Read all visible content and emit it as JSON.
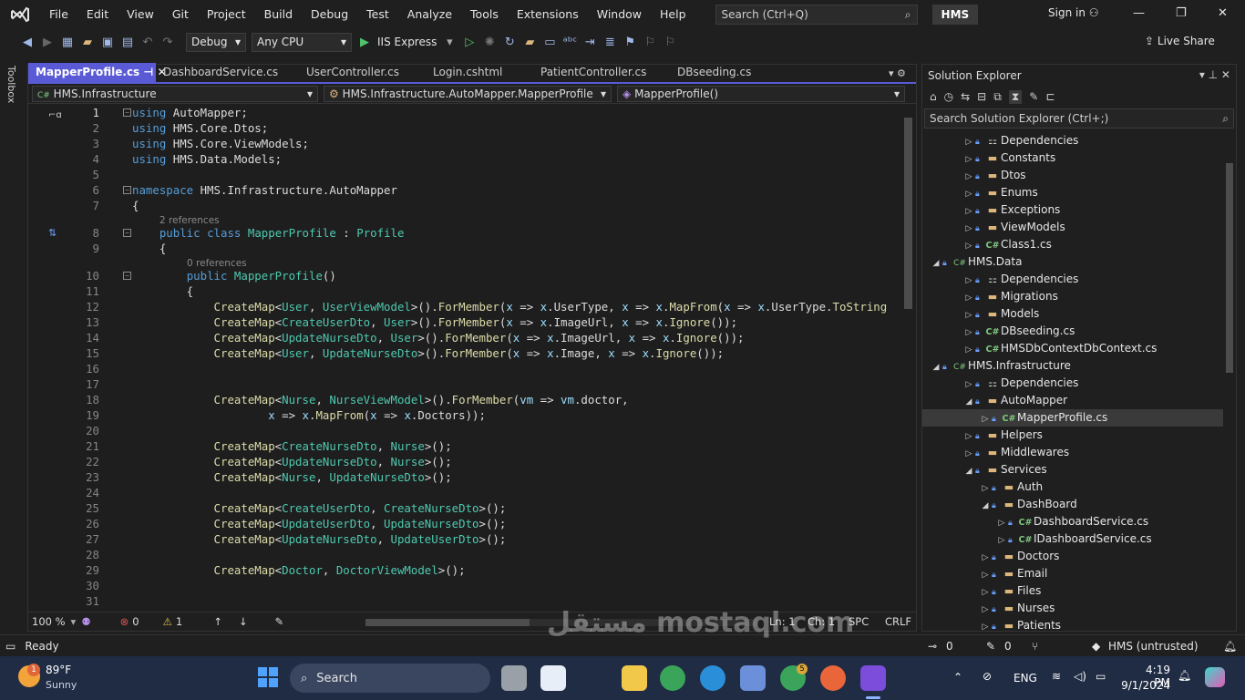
{
  "menu": [
    "File",
    "Edit",
    "View",
    "Git",
    "Project",
    "Build",
    "Debug",
    "Test",
    "Analyze",
    "Tools",
    "Extensions",
    "Window",
    "Help"
  ],
  "search": {
    "placeholder": "Search (Ctrl+Q)"
  },
  "solution_badge": "HMS",
  "signin": "Sign in",
  "toolbar": {
    "config": "Debug",
    "platform": "Any CPU",
    "run_label": "IIS Express",
    "live_share": "Live Share"
  },
  "toolbox_label": "Toolbox",
  "tabs": [
    "MapperProfile.cs",
    "DashboardService.cs",
    "UserController.cs",
    "Login.cshtml",
    "PatientController.cs",
    "DBseeding.cs"
  ],
  "nav": {
    "project": "HMS.Infrastructure",
    "class": "HMS.Infrastructure.AutoMapper.MapperProfile",
    "member": "MapperProfile()"
  },
  "code_lines": [
    {
      "n": "1",
      "t": "using AutoMapper;"
    },
    {
      "n": "2",
      "t": "using HMS.Core.Dtos;"
    },
    {
      "n": "3",
      "t": "using HMS.Core.ViewModels;"
    },
    {
      "n": "4",
      "t": "using HMS.Data.Models;"
    },
    {
      "n": "5",
      "t": ""
    },
    {
      "n": "6",
      "t": "namespace HMS.Infrastructure.AutoMapper"
    },
    {
      "n": "7",
      "t": "{"
    },
    {
      "n": "",
      "t": "2 references"
    },
    {
      "n": "8",
      "t": "    public class MapperProfile : Profile"
    },
    {
      "n": "9",
      "t": "    {"
    },
    {
      "n": "",
      "t": "0 references"
    },
    {
      "n": "10",
      "t": "        public MapperProfile()"
    },
    {
      "n": "11",
      "t": "        {"
    },
    {
      "n": "12",
      "t": "            CreateMap<User, UserViewModel>().ForMember(x => x.UserType, x => x.MapFrom(x => x.UserType.ToString"
    },
    {
      "n": "13",
      "t": "            CreateMap<CreateUserDto, User>().ForMember(x => x.ImageUrl, x => x.Ignore());"
    },
    {
      "n": "14",
      "t": "            CreateMap<UpdateNurseDto, User>().ForMember(x => x.ImageUrl, x => x.Ignore());"
    },
    {
      "n": "15",
      "t": "            CreateMap<User, UpdateNurseDto>().ForMember(x => x.Image, x => x.Ignore());"
    },
    {
      "n": "16",
      "t": ""
    },
    {
      "n": "17",
      "t": ""
    },
    {
      "n": "18",
      "t": "            CreateMap<Nurse, NurseViewModel>().ForMember(vm => vm.doctor,"
    },
    {
      "n": "19",
      "t": "                    x => x.MapFrom(x => x.Doctors));"
    },
    {
      "n": "20",
      "t": ""
    },
    {
      "n": "21",
      "t": "            CreateMap<CreateNurseDto, Nurse>();"
    },
    {
      "n": "22",
      "t": "            CreateMap<UpdateNurseDto, Nurse>();"
    },
    {
      "n": "23",
      "t": "            CreateMap<Nurse, UpdateNurseDto>();"
    },
    {
      "n": "24",
      "t": ""
    },
    {
      "n": "25",
      "t": "            CreateMap<CreateUserDto, CreateNurseDto>();"
    },
    {
      "n": "26",
      "t": "            CreateMap<UpdateUserDto, UpdateNurseDto>();"
    },
    {
      "n": "27",
      "t": "            CreateMap<UpdateNurseDto, UpdateUserDto>();"
    },
    {
      "n": "28",
      "t": ""
    },
    {
      "n": "29",
      "t": "            CreateMap<Doctor, DoctorViewModel>();"
    },
    {
      "n": "30",
      "t": ""
    },
    {
      "n": "31",
      "t": ""
    }
  ],
  "editor_status": {
    "zoom": "100 %",
    "errors": "0",
    "warnings": "1",
    "line": "Ln: 1",
    "col": "Ch: 1",
    "spc": "SPC",
    "crlf": "CRLF"
  },
  "solution_explorer": {
    "title": "Solution Explorer",
    "search_placeholder": "Search Solution Explorer (Ctrl+;)",
    "nodes": [
      {
        "label": "Dependencies",
        "depth": 1,
        "icon": "dep",
        "exp": "▷"
      },
      {
        "label": "Constants",
        "depth": 1,
        "icon": "folder",
        "exp": "▷"
      },
      {
        "label": "Dtos",
        "depth": 1,
        "icon": "folder",
        "exp": "▷"
      },
      {
        "label": "Enums",
        "depth": 1,
        "icon": "folder",
        "exp": "▷"
      },
      {
        "label": "Exceptions",
        "depth": 1,
        "icon": "folder",
        "exp": "▷"
      },
      {
        "label": "ViewModels",
        "depth": 1,
        "icon": "folder",
        "exp": "▷"
      },
      {
        "label": "Class1.cs",
        "depth": 1,
        "icon": "cs",
        "exp": "▷"
      },
      {
        "label": "HMS.Data",
        "depth": 0,
        "icon": "proj",
        "exp": "◢"
      },
      {
        "label": "Dependencies",
        "depth": 1,
        "icon": "dep",
        "exp": "▷"
      },
      {
        "label": "Migrations",
        "depth": 1,
        "icon": "folder",
        "exp": "▷"
      },
      {
        "label": "Models",
        "depth": 1,
        "icon": "folder",
        "exp": "▷"
      },
      {
        "label": "DBseeding.cs",
        "depth": 1,
        "icon": "cs",
        "exp": "▷"
      },
      {
        "label": "HMSDbContextDbContext.cs",
        "depth": 1,
        "icon": "cs",
        "exp": "▷"
      },
      {
        "label": "HMS.Infrastructure",
        "depth": 0,
        "icon": "proj",
        "exp": "◢"
      },
      {
        "label": "Dependencies",
        "depth": 1,
        "icon": "dep",
        "exp": "▷"
      },
      {
        "label": "AutoMapper",
        "depth": 1,
        "icon": "folder",
        "exp": "◢"
      },
      {
        "label": "MapperProfile.cs",
        "depth": 2,
        "icon": "cs",
        "exp": "▷",
        "selected": true
      },
      {
        "label": "Helpers",
        "depth": 1,
        "icon": "folder",
        "exp": "▷"
      },
      {
        "label": "Middlewares",
        "depth": 1,
        "icon": "folder",
        "exp": "▷"
      },
      {
        "label": "Services",
        "depth": 1,
        "icon": "folder",
        "exp": "◢"
      },
      {
        "label": "Auth",
        "depth": 2,
        "icon": "folder",
        "exp": "▷"
      },
      {
        "label": "DashBoard",
        "depth": 2,
        "icon": "folder",
        "exp": "◢"
      },
      {
        "label": "DashboardService.cs",
        "depth": 3,
        "icon": "cs",
        "exp": "▷"
      },
      {
        "label": "IDashboardService.cs",
        "depth": 3,
        "icon": "cs",
        "exp": "▷"
      },
      {
        "label": "Doctors",
        "depth": 2,
        "icon": "folder",
        "exp": "▷"
      },
      {
        "label": "Email",
        "depth": 2,
        "icon": "folder",
        "exp": "▷"
      },
      {
        "label": "Files",
        "depth": 2,
        "icon": "folder",
        "exp": "▷"
      },
      {
        "label": "Nurses",
        "depth": 2,
        "icon": "folder",
        "exp": "▷"
      },
      {
        "label": "Patients",
        "depth": 2,
        "icon": "folder",
        "exp": "▷"
      }
    ]
  },
  "statusbar": {
    "ready": "Ready",
    "commits": "0",
    "edits": "0",
    "branch": "HMS (untrusted)"
  },
  "taskbar": {
    "temp": "89°F",
    "weather": "Sunny",
    "search": "Search",
    "lang": "ENG",
    "time": "4:19 PM",
    "date": "9/1/2024",
    "weather_badge": "1",
    "chrome_badge": "5"
  },
  "watermark": "مستقل mostaql.com"
}
